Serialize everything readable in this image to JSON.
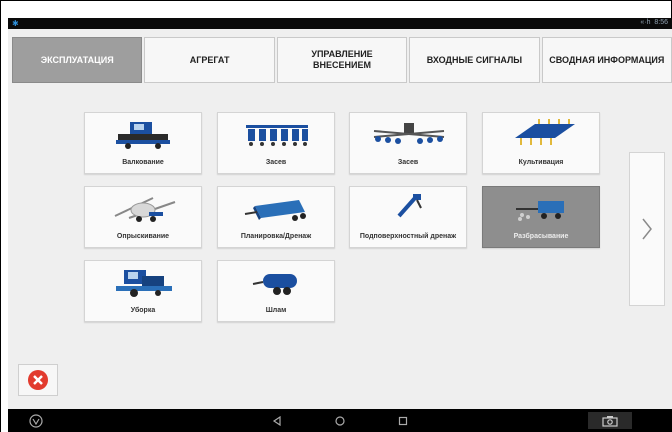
{
  "status": {
    "time": "8:56",
    "signal": "«·h"
  },
  "tabs": [
    {
      "label": "ЭКСПЛУАТАЦИЯ",
      "active": true
    },
    {
      "label": "АГРЕГАТ",
      "active": false
    },
    {
      "label": "УПРАВЛЕНИЕ ВНЕСЕНИЕМ",
      "active": false
    },
    {
      "label": "ВХОДНЫЕ СИГНАЛЫ",
      "active": false
    },
    {
      "label": "СВОДНАЯ ИНФОРМАЦИЯ",
      "active": false
    }
  ],
  "operations": [
    {
      "label": "Валкование",
      "icon": "windrower-icon"
    },
    {
      "label": "Засев",
      "icon": "planter-icon"
    },
    {
      "label": "Засев",
      "icon": "air-seeder-icon"
    },
    {
      "label": "Культивация",
      "icon": "cultivator-icon"
    },
    {
      "label": "Опрыскивание",
      "icon": "sprayer-icon"
    },
    {
      "label": "Планировка/Дренаж",
      "icon": "land-leveler-icon"
    },
    {
      "label": "Подповерхностный дренаж",
      "icon": "tile-plow-icon"
    },
    {
      "label": "Разбрасывание",
      "icon": "spreader-icon",
      "selected": true
    },
    {
      "label": "Уборка",
      "icon": "combine-icon"
    },
    {
      "label": "Шлам",
      "icon": "slurry-tank-icon"
    }
  ],
  "colors": {
    "brand_blue": "#1b4fa0",
    "selected_tile": "#8e8e8e",
    "active_tab": "#9e9e9e",
    "close_red": "#e23b2e"
  }
}
